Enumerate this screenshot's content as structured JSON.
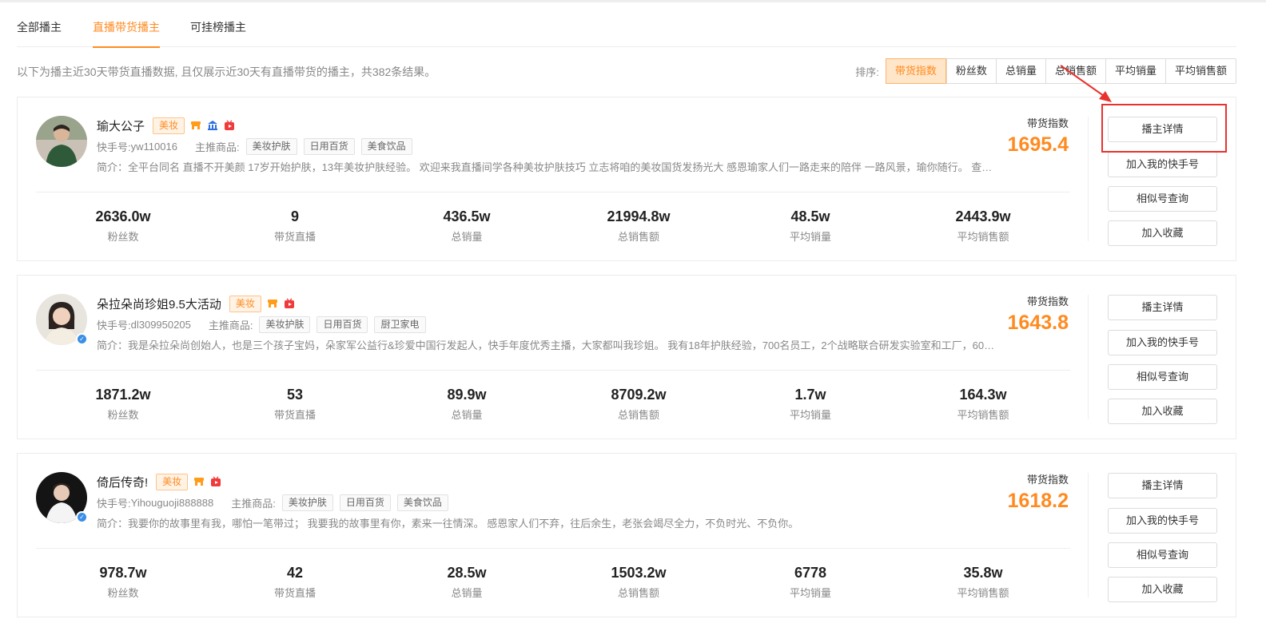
{
  "tabs": [
    {
      "label": "全部播主",
      "active": false
    },
    {
      "label": "直播带货播主",
      "active": true
    },
    {
      "label": "可挂榜播主",
      "active": false
    }
  ],
  "summary": "以下为播主近30天带货直播数据, 且仅展示近30天有直播带货的播主，共382条结果。",
  "sort": {
    "label": "排序:",
    "options": [
      {
        "label": "带货指数",
        "active": true
      },
      {
        "label": "粉丝数",
        "active": false
      },
      {
        "label": "总销量",
        "active": false
      },
      {
        "label": "总销售额",
        "active": false
      },
      {
        "label": "平均销量",
        "active": false
      },
      {
        "label": "平均销售额",
        "active": false
      }
    ]
  },
  "labels": {
    "account_prefix": "快手号:",
    "goods_prefix": "主推商品:",
    "index_label": "带货指数"
  },
  "actions": [
    "播主详情",
    "加入我的快手号",
    "相似号查询",
    "加入收藏"
  ],
  "stat_labels": [
    "粉丝数",
    "带货直播",
    "总销量",
    "总销售额",
    "平均销量",
    "平均销售额"
  ],
  "accent_color": "#ff8a1f",
  "cards": [
    {
      "name": "瑜大公子",
      "category": "美妆",
      "badges": [
        "shop-icon",
        "bank-icon",
        "live-icon"
      ],
      "verified": false,
      "account": "yw110016",
      "goods": [
        "美妆护肤",
        "日用百货",
        "美食饮品"
      ],
      "intro": "简介：全平台同名 直播不开美颜 17岁开始护肤，13年美妆护肤经验。 欢迎来我直播间学各种美妆护肤技巧 立志将咱的美妆国货发扬光大 感恩瑜家人们一路走来的陪伴 一路风景，瑜你随行。 查单...",
      "index": "1695.4",
      "stats": [
        "2636.0w",
        "9",
        "436.5w",
        "21994.8w",
        "48.5w",
        "2443.9w"
      ]
    },
    {
      "name": "朵拉朵尚珍姐9.5大活动",
      "category": "美妆",
      "badges": [
        "shop-icon",
        "live-icon"
      ],
      "verified": true,
      "account": "dl309950205",
      "goods": [
        "美妆护肤",
        "日用百货",
        "厨卫家电"
      ],
      "intro": "简介：我是朵拉朵尚创始人，也是三个孩子宝妈，朵家军公益行&珍爱中国行发起人，快手年度优秀主播，大家都叫我珍姐。 我有18年护肤经验，700名员工，2个战略联合研发实验室和工厂，600...",
      "index": "1643.8",
      "stats": [
        "1871.2w",
        "53",
        "89.9w",
        "8709.2w",
        "1.7w",
        "164.3w"
      ]
    },
    {
      "name": "倚后传奇!",
      "category": "美妆",
      "badges": [
        "shop-icon",
        "live-icon"
      ],
      "verified": true,
      "account": "Yihouguoji888888",
      "goods": [
        "美妆护肤",
        "日用百货",
        "美食饮品"
      ],
      "intro": "简介：我要你的故事里有我，哪怕一笔带过； 我要我的故事里有你，素来一往情深。 感恩家人们不弃，往后余生，老张会竭尽全力，不负时光、不负你。",
      "index": "1618.2",
      "stats": [
        "978.7w",
        "42",
        "28.5w",
        "1503.2w",
        "6778",
        "35.8w"
      ]
    }
  ]
}
